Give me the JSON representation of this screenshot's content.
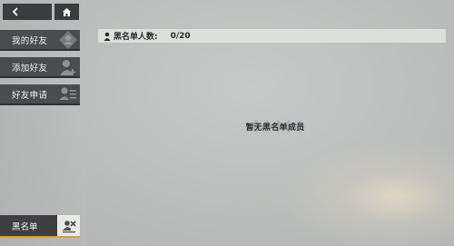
{
  "sidebar": {
    "tabs": [
      {
        "label": "我的好友",
        "icon": "user-diamond-icon"
      },
      {
        "label": "添加好友",
        "icon": "add-user-icon"
      },
      {
        "label": "好友申请",
        "icon": "friend-request-icon"
      }
    ],
    "blacklist_tab": {
      "label": "黑名单",
      "icon": "blacklist-icon",
      "selected": true
    }
  },
  "topbar": {
    "back_icon": "chevron-left-icon",
    "home_icon": "home-icon"
  },
  "main": {
    "blacklist_count_label": "黑名单人数:",
    "blacklist_count_value": "0/20",
    "empty_message": "暂无黑名单成员"
  },
  "colors": {
    "accent": "#e89a2c",
    "tab_bg": "#4a4c4e",
    "header_bar": "#dedfdd"
  }
}
